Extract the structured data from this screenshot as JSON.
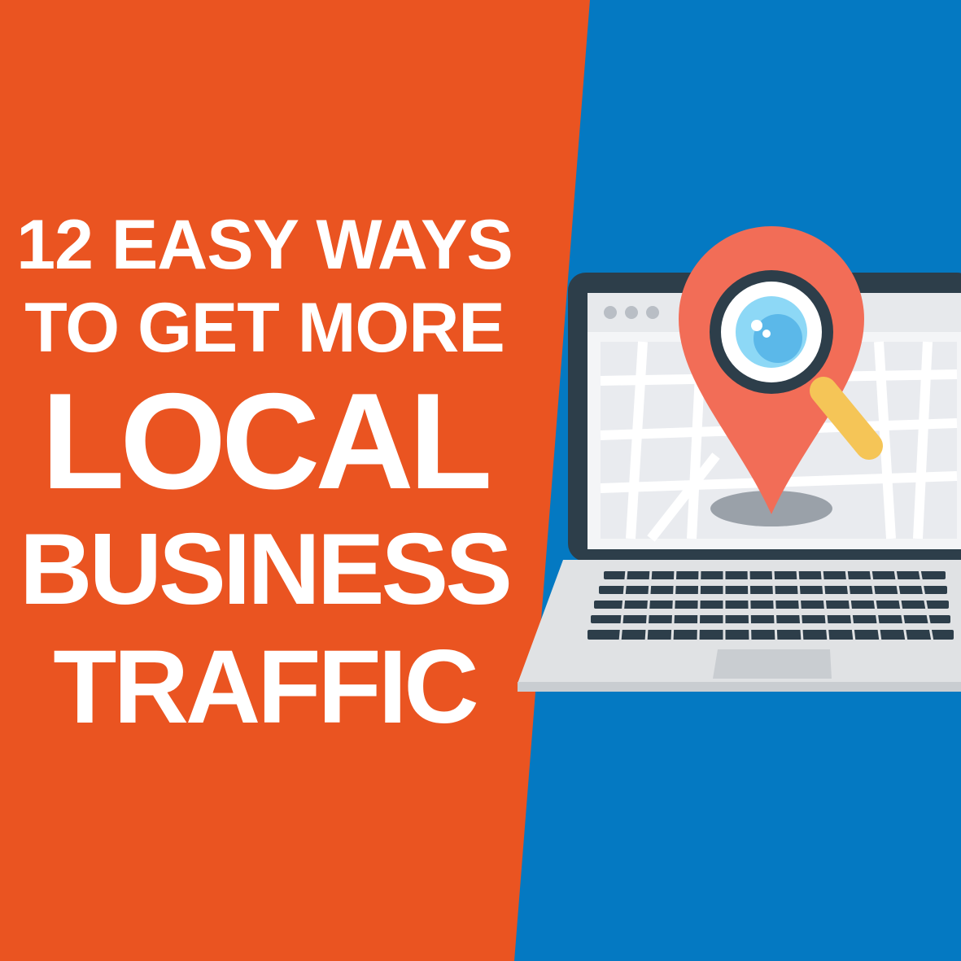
{
  "headline": {
    "line1": "12 EASY WAYS",
    "line2": "TO GET MORE",
    "line3": "LOCAL",
    "line4": "BUSINESS",
    "line5": "TRAFFIC"
  },
  "colors": {
    "left_panel": "#ea5421",
    "right_panel": "#0479c2",
    "laptop_frame": "#2d3e4a",
    "map_pin": "#f26d57",
    "magnifier_handle": "#f5c557",
    "lens": "#5fc3ef",
    "keyboard_base": "#e0e2e4"
  },
  "icons": {
    "illustration": "laptop-map-icon",
    "pin": "map-pin-icon",
    "magnifier": "magnifying-glass-icon"
  }
}
